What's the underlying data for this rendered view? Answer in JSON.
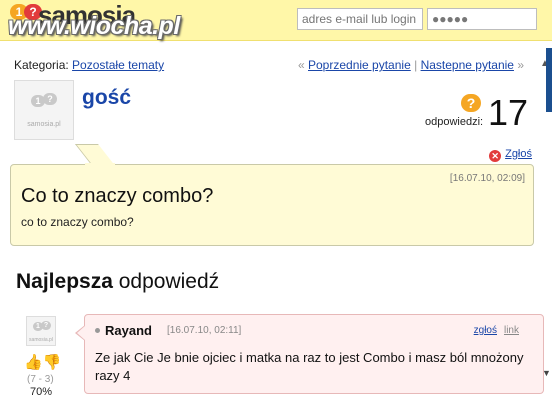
{
  "header": {
    "logo_text": "samosia",
    "logo_badge_one": "1",
    "logo_badge_q": "?",
    "watermark": "www.wiocha.pl",
    "email_placeholder": "adres e-mail lub login",
    "password_value": "●●●●●"
  },
  "category": {
    "label": "Kategoria:",
    "value": "Pozostałe tematy"
  },
  "navigation": {
    "prev_arrow": "«",
    "prev_label": "Poprzednie pytanie",
    "separator": "|",
    "next_label": "Nastepne pytanie",
    "next_arrow": "»"
  },
  "question": {
    "author": "gość",
    "answers_label": "odpowiedzi:",
    "answers_count": "17",
    "report_label": "Zgłoś",
    "date": "[16.07.10, 02:09]",
    "title": "Co to znaczy combo?",
    "body": "co to znaczy combo?"
  },
  "best_answer": {
    "heading_bold": "Najlepsza",
    "heading_rest": " odpowiedź",
    "author": "Rayand",
    "date": "[16.07.10, 02:11]",
    "report_label": "zgłoś",
    "link_label": "link",
    "text": "Ze jak Cie Je bnie ojciec i matka na raz to jest Combo i masz ból mnożony razy 4",
    "votes": "(7 - 3)",
    "percent": "70%"
  },
  "avatar_site_label": "samosia.pl",
  "colors": {
    "header_bg": "#fff7a8",
    "link": "#1a46a8",
    "question_box": "#fffbd6",
    "answer_box": "#fff0f0",
    "answer_icon": "#f5a623",
    "report_icon": "#e23b3b"
  }
}
